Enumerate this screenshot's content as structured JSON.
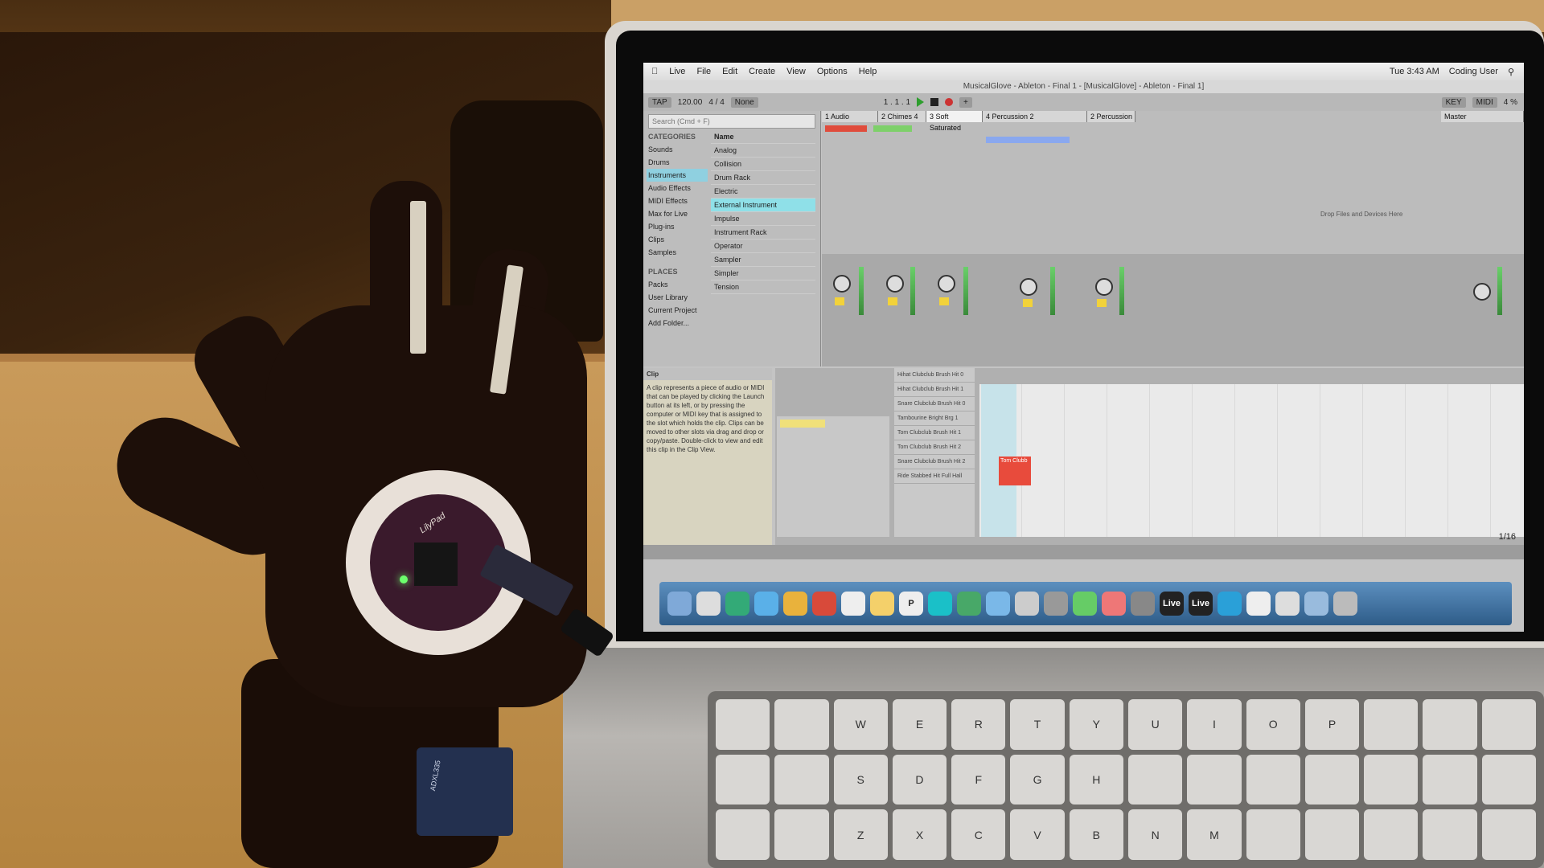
{
  "scene": {
    "laptop_screen": {
      "menubar": {
        "items": [
          "Live",
          "File",
          "Edit",
          "Create",
          "View",
          "Options",
          "Help"
        ],
        "clock": "Tue 3:43 AM",
        "user": "Coding User"
      },
      "window_title": "MusicalGlove - Ableton - Final 1 - [MusicalGlove] - Ableton - Final 1]",
      "transport": {
        "tap_label": "TAP",
        "tempo": "120.00",
        "signature": "4 / 4",
        "quantize": "None",
        "position": "1 . 1 . 1",
        "key_label": "KEY",
        "midi_label": "MIDI",
        "cpu": "4 %"
      },
      "browser": {
        "search_placeholder": "Search (Cmd + F)",
        "categories_header": "CATEGORIES",
        "categories": [
          "Sounds",
          "Drums",
          "Instruments",
          "Audio Effects",
          "MIDI Effects",
          "Max for Live",
          "Plug-ins",
          "Clips",
          "Samples"
        ],
        "places_header": "PLACES",
        "places": [
          "Packs",
          "User Library",
          "Current Project",
          "Add Folder..."
        ],
        "name_header": "Name",
        "names": [
          "Analog",
          "Collision",
          "Drum Rack",
          "Electric",
          "External Instrument",
          "Impulse",
          "Instrument Rack",
          "Operator",
          "Sampler",
          "Simpler",
          "Tension"
        ]
      },
      "tracks": [
        "1 Audio",
        "2 Chimes 4",
        "3 Soft Saturated",
        "4 Percussion 2",
        "2 Percussion",
        "Master"
      ],
      "drop_text": "Drop Files and Devices Here",
      "info": {
        "title": "Clip",
        "body": "A clip represents a piece of audio or MIDI that can be played by clicking the Launch button at its left, or by pressing the computer or MIDI key that is assigned to the slot which holds the clip. Clips can be moved to other slots via drag and drop or copy/paste. Double-click to view and edit this clip in the Clip View."
      },
      "devices": [
        "Hihat Clubclub Brush Hit 0",
        "Hihat Clubclub Brush Hit 1",
        "Snare Clubclub Brush Hit 0",
        "Tambourine Bright Brg 1",
        "Tom Clubclub Brush Hit 1",
        "Tom Clubclub Brush Hit 2",
        "Snare Clubclub Brush Hit 2",
        "Ride Stabbed Hit Full Hall"
      ],
      "note_label": "Tom Clubb",
      "page_count": "1/16"
    },
    "dock_labels": [
      "P",
      "Live",
      "Live"
    ],
    "keyboard_keys": [
      "W",
      "E",
      "R",
      "T",
      "Y",
      "U",
      "I",
      "O",
      "P",
      "S",
      "D",
      "F",
      "G",
      "H",
      "Z",
      "X",
      "C",
      "V",
      "B",
      "N",
      "M"
    ],
    "board_label": "LilyPad",
    "sensor_label": "ADXL335"
  }
}
